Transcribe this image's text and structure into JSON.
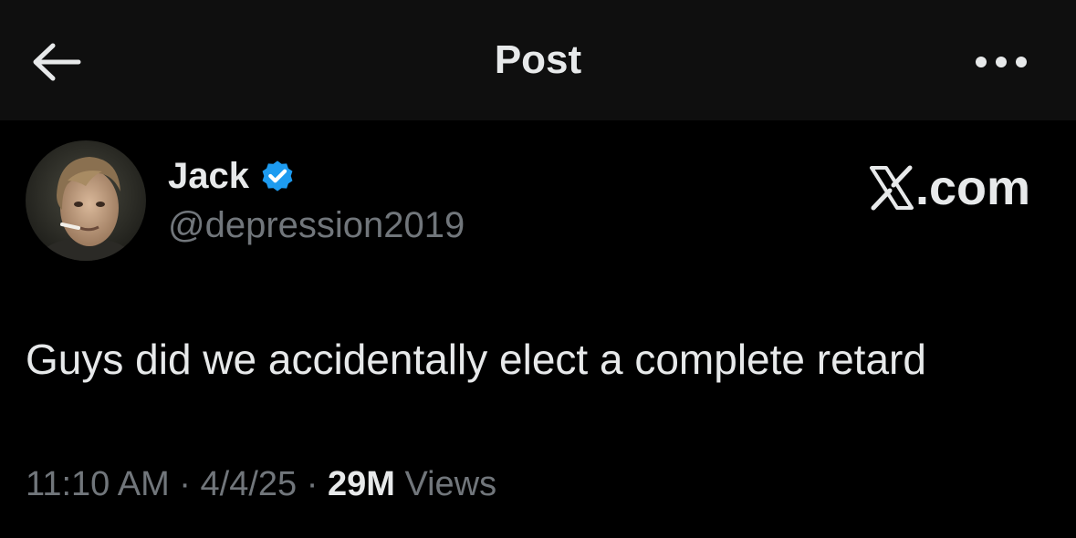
{
  "header": {
    "title": "Post",
    "back_icon": "arrow-left-icon",
    "more_icon": "more-horizontal-icon"
  },
  "author": {
    "display_name": "Jack",
    "handle": "@depression2019",
    "verified": true,
    "verified_color": "#1d9bf0",
    "avatar": "profile-photo"
  },
  "watermark": {
    "text": ".com",
    "logo": "x-logo-icon"
  },
  "tweet": {
    "text": "Guys did we accidentally elect a complete retard"
  },
  "meta": {
    "time": "11:10 AM",
    "separator": " · ",
    "date": "4/4/25",
    "views_count": "29M",
    "views_label": "Views"
  },
  "colors": {
    "background": "#000000",
    "topbar": "#0f0f0f",
    "primary_text": "#e7e9ea",
    "secondary_text": "#71767b",
    "accent": "#1d9bf0"
  }
}
